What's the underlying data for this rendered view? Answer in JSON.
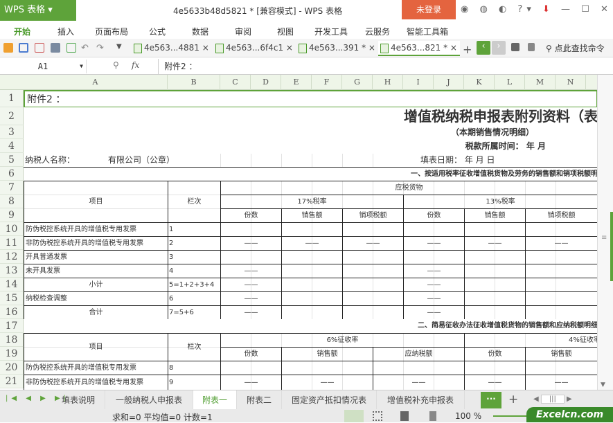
{
  "app": {
    "logo": "WPS 表格",
    "title": "4e5633b48d5821 * [兼容模式] - WPS 表格",
    "login": "未登录"
  },
  "menu": [
    "开始",
    "插入",
    "页面布局",
    "公式",
    "数据",
    "审阅",
    "视图",
    "开发工具",
    "云服务",
    "智能工具箱"
  ],
  "doc_tabs": [
    "4e563...4881",
    "4e563...6f4c1",
    "4e563...391 *",
    "4e563...821 *"
  ],
  "search_cmd": "点此查找命令",
  "formula": {
    "cell": "A1",
    "fx": "fx",
    "value": "附件2  ："
  },
  "columns": [
    "A",
    "B",
    "C",
    "D",
    "E",
    "F",
    "G",
    "H",
    "I",
    "J",
    "K",
    "L",
    "M",
    "N"
  ],
  "rows": [
    "1",
    "2",
    "3",
    "4",
    "5",
    "6",
    "7",
    "8",
    "9",
    "10",
    "11",
    "12",
    "13",
    "14",
    "15",
    "16",
    "17",
    "18",
    "19",
    "20",
    "21"
  ],
  "sheet": {
    "a1": "附件2  ：",
    "title": "增值税纳税申报表附列资料（表",
    "subtitle": "（本期销售情况明细）",
    "period": "税款所属时间：      年    月",
    "taxpayer": "纳税人名称：",
    "company": "有限公司（公章）",
    "fill_date": "填表日期：    年   月   日",
    "section1": "一、按适用税率征收增值税货物及劳务的销售额和销项税额明",
    "item": "项目",
    "col": "栏次",
    "taxable": "应税货物",
    "rate17": "17%税率",
    "rate13": "13%税率",
    "sub_headers": [
      "份数",
      "销售额",
      "销项税额",
      "份数",
      "销售额",
      "销项税额"
    ],
    "s1_rows": [
      {
        "label": "防伪税控系统开具的增值税专用发票",
        "col": "1",
        "vals": [
          "",
          "",
          "",
          "",
          "",
          ""
        ]
      },
      {
        "label": "非防伪税控系统开具的增值税专用发票",
        "col": "2",
        "vals": [
          "——",
          "——",
          "——",
          "——",
          "——",
          "——"
        ]
      },
      {
        "label": "开具普通发票",
        "col": "3",
        "vals": [
          "",
          "",
          "",
          "",
          "",
          ""
        ]
      },
      {
        "label": "未开具发票",
        "col": "4",
        "vals": [
          "——",
          "",
          "",
          "——",
          "",
          ""
        ]
      },
      {
        "label": "小计",
        "col": "5=1+2+3+4",
        "center": true,
        "vals": [
          "——",
          "",
          "",
          "——",
          "",
          ""
        ]
      },
      {
        "label": "纳税检查调整",
        "col": "6",
        "vals": [
          "——",
          "",
          "",
          "——",
          "",
          ""
        ]
      },
      {
        "label": "合计",
        "col": "7=5+6",
        "center": true,
        "vals": [
          "——",
          "",
          "",
          "——",
          "",
          ""
        ]
      }
    ],
    "section2": "二、简易征收办法征收增值税货物的销售额和应纳税额明细",
    "rate6": "6%征收率",
    "rate4": "4%征收率",
    "s2_headers": [
      "份数",
      "销售额",
      "应纳税额",
      "份数",
      "销售额"
    ],
    "s2_rows": [
      {
        "label": "防伪税控系统开具的增值税专用发票",
        "col": "8",
        "vals": [
          "",
          "",
          "",
          "",
          ""
        ]
      },
      {
        "label": "非防伪税控系统开具的增值税专用发票",
        "col": "9",
        "vals": [
          "——",
          "——",
          "——",
          "——",
          "——"
        ]
      }
    ]
  },
  "sheet_tabs": [
    "填表说明",
    "一般纳税人申报表",
    "附表一",
    "附表二",
    "固定资产抵扣情况表",
    "增值税补充申报表"
  ],
  "status": {
    "summary": "求和=0  平均值=0  计数=1",
    "zoom": "100 %",
    "watermark": "Excelcn.com"
  }
}
